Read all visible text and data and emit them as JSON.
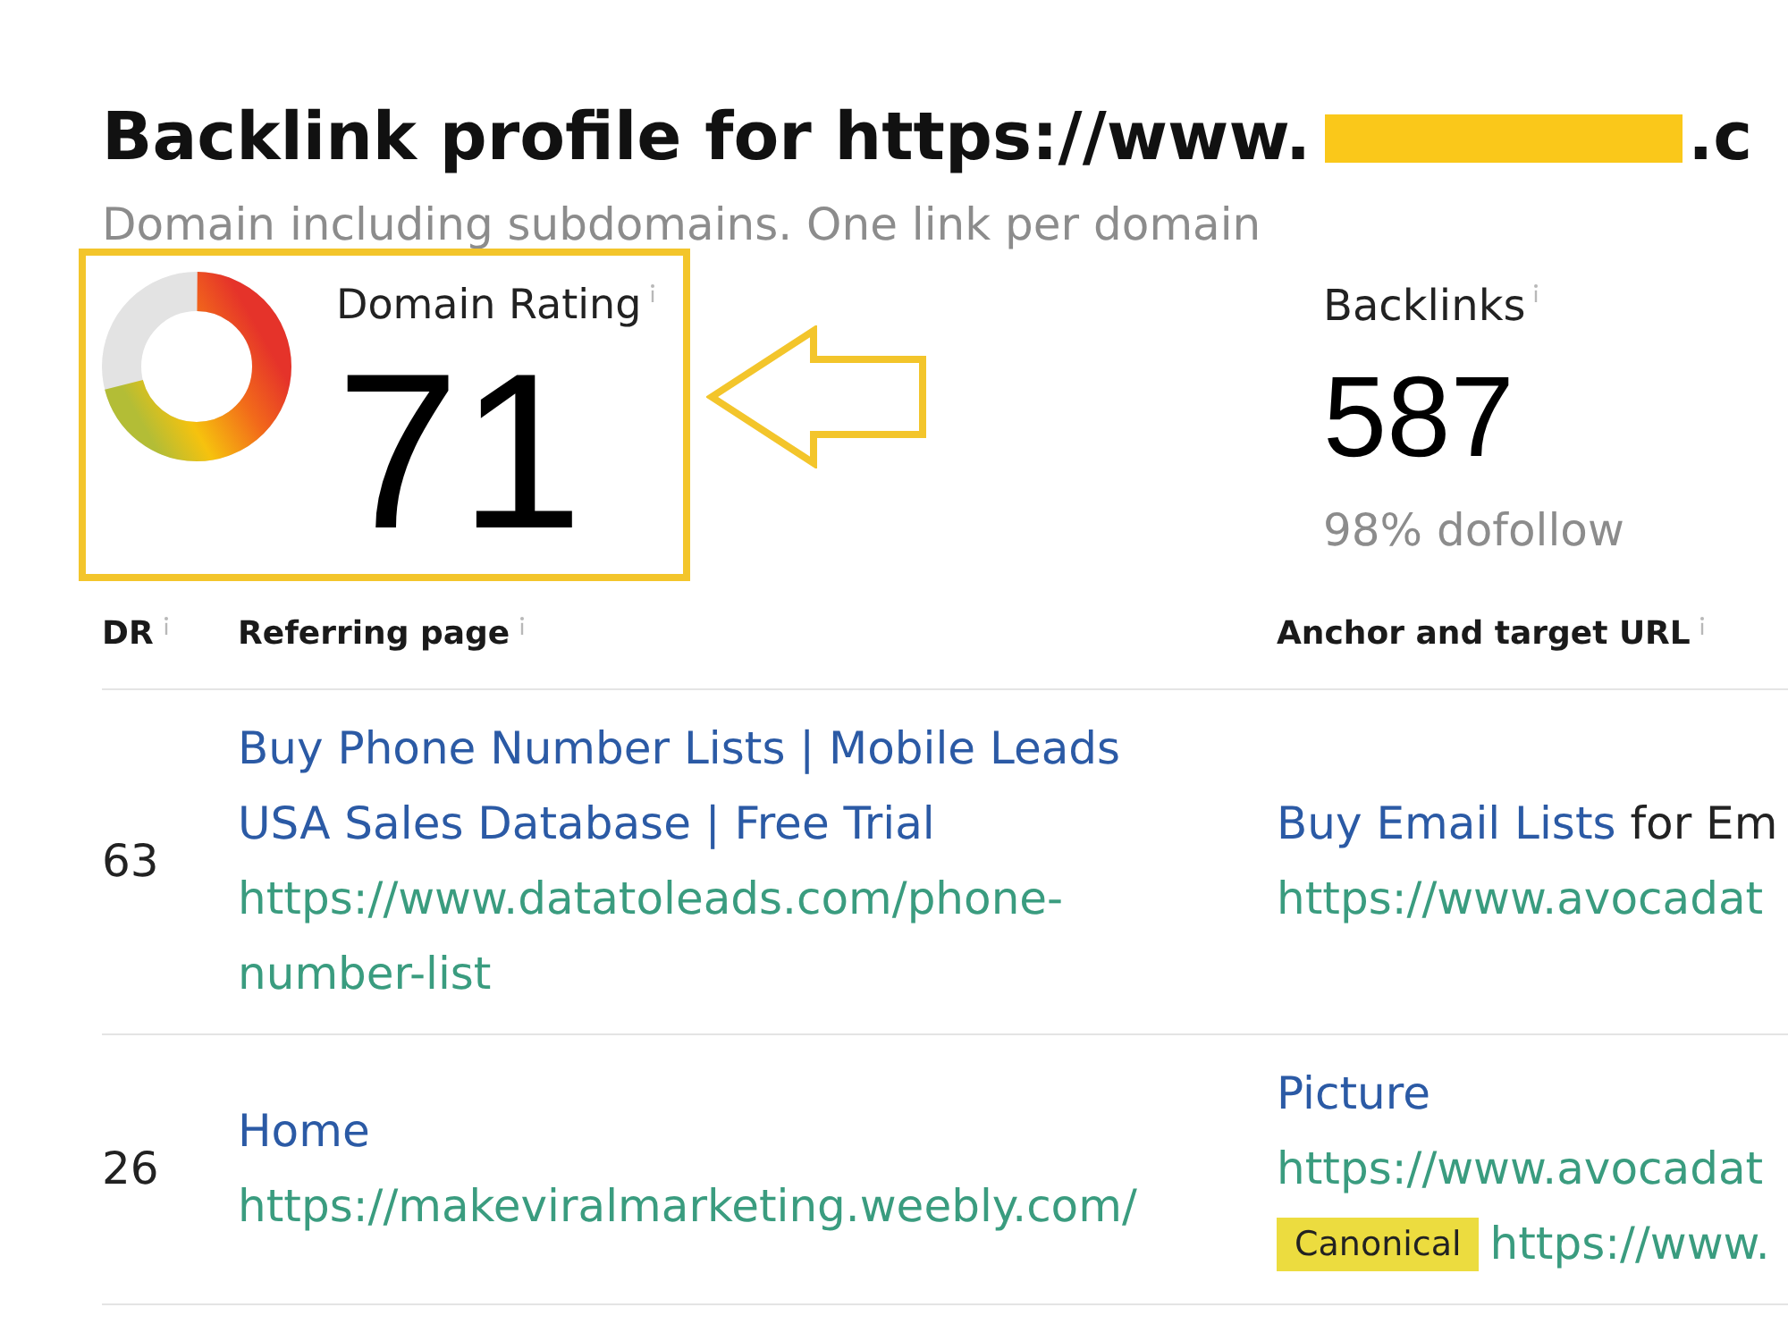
{
  "title": {
    "text": "Backlink profile for https://www.",
    "redacted": true,
    "text_end": ".c"
  },
  "subtitle": "Domain including subdomains. One link per domain",
  "metrics": [
    {
      "kind": "rating",
      "label": "Domain Rating",
      "value": "71",
      "level": 0.71,
      "highlighted": true
    },
    {
      "kind": "count",
      "label": "Backlinks",
      "value": "587",
      "note": "98% dofollow",
      "highlighted": false
    }
  ],
  "table": {
    "columns": [
      "DR",
      "Referring page",
      "Anchor and target URL"
    ],
    "rows": [
      {
        "dr": "63",
        "page_title": "Buy Phone Number Lists | Mobile Leads USA Sales Database | Free Trial",
        "page_url": "https://www.datatoleads.com/phone-number-list",
        "anchor": "Buy Email Lists",
        "anchor_after": "for Em",
        "target_url": "https://www.avocadat"
      },
      {
        "dr": "26",
        "page_title": "Home",
        "page_url": "https://makeviralmarketing.weebly.com/",
        "anchor": "Picture",
        "target_url": "https://www.avocadat",
        "canonical": {
          "badge": "Canonical",
          "url": "https://www."
        }
      }
    ]
  }
}
